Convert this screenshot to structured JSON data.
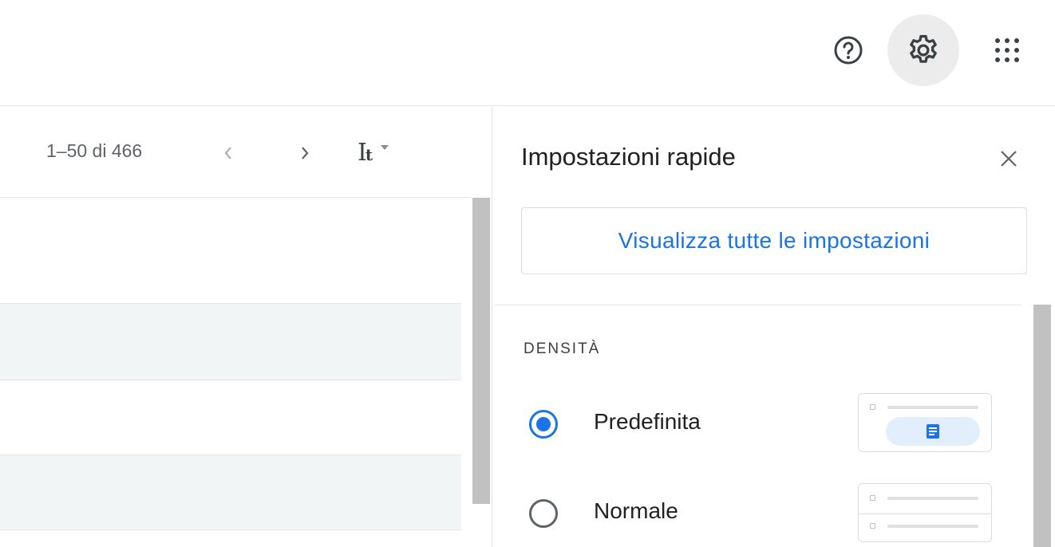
{
  "header": {
    "help_icon": "help-circle-icon",
    "settings_icon": "gear-icon",
    "apps_icon": "apps-grid-icon"
  },
  "toolbar": {
    "pagination": "1–50 di 466",
    "prev_icon": "chevron-left-icon",
    "next_icon": "chevron-right-icon",
    "text_size_icon": "text-size-icon"
  },
  "quick_settings": {
    "title": "Impostazioni rapide",
    "close_icon": "close-icon",
    "all_settings_label": "Visualizza tutte le impostazioni",
    "density": {
      "heading": "DENSITÀ",
      "options": [
        {
          "label": "Predefinita",
          "selected": true
        },
        {
          "label": "Normale",
          "selected": false
        }
      ]
    }
  },
  "colors": {
    "accent": "#1a73e8",
    "selected_pill": "#e3eefc",
    "row_shade": "#f2f5f5",
    "active_icon_bg": "#ececec"
  }
}
